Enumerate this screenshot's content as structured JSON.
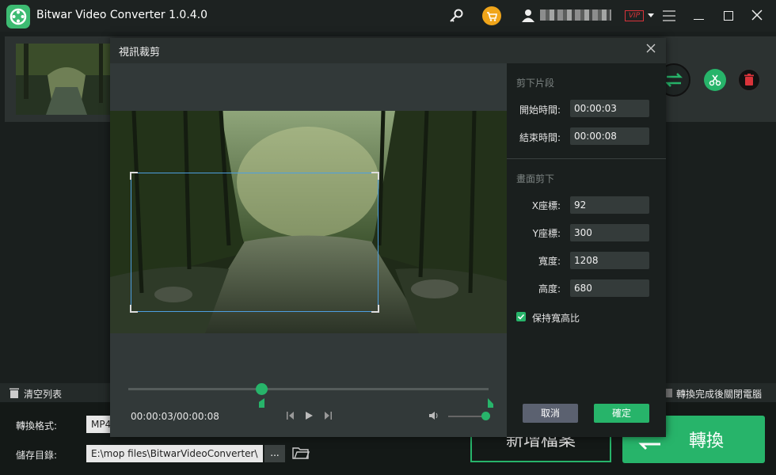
{
  "app": {
    "title": "Bitwar Video Converter  1.0.4.0"
  },
  "dialog": {
    "title": "視訊裁剪",
    "trim": {
      "heading": "剪下片段",
      "start_label": "開始時間:",
      "start_value": "00:00:03",
      "end_label": "結束時間:",
      "end_value": "00:00:08"
    },
    "crop": {
      "heading": "畫面剪下",
      "x_label": "X座標:",
      "x_value": "92",
      "y_label": "Y座標:",
      "y_value": "300",
      "w_label": "寬度:",
      "w_value": "1208",
      "h_label": "高度:",
      "h_value": "680",
      "keep_ratio_label": "保持寬高比"
    },
    "time_display": "00:00:03/00:00:08",
    "cancel_label": "取消",
    "ok_label": "確定"
  },
  "bottom": {
    "clear_list": "清空列表",
    "shutdown": "轉換完成後關閉電腦",
    "format_label": "轉換格式:",
    "format_value": "MP4",
    "save_label": "儲存目錄:",
    "save_path": "E:\\mop files\\BitwarVideoConverter\\",
    "browse_label": "...",
    "add_file": "新增檔案",
    "convert": "轉換"
  },
  "icons": {
    "key": "key-icon",
    "cart": "cart-icon",
    "user": "user-icon",
    "menu": "menu-icon",
    "minimize": "minimize-icon",
    "maximize": "maximize-icon",
    "close": "close-icon",
    "convert": "convert-icon",
    "cut": "scissors-icon",
    "delete": "trash-icon",
    "folder": "folder-icon",
    "volume": "volume-icon",
    "prev": "prev-frame-icon",
    "play": "play-icon",
    "next": "next-frame-icon",
    "check": "checkbox-icon"
  },
  "colors": {
    "accent": "#27b46a",
    "vip": "#d9333a"
  },
  "playback": {
    "progress_fraction": 0.37,
    "volume_fraction": 1.0
  },
  "crop_options": {
    "keep_ratio": true
  }
}
